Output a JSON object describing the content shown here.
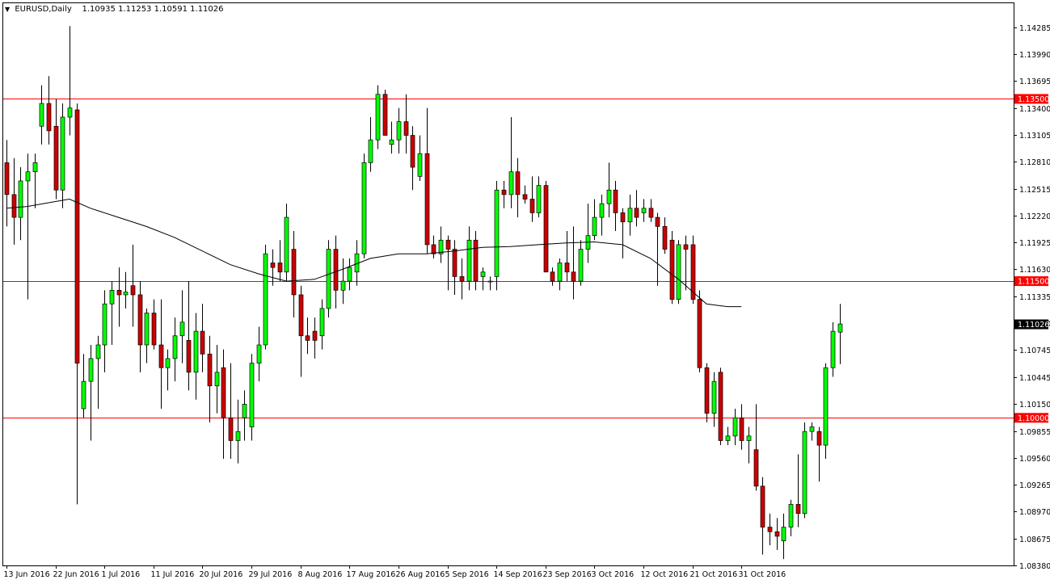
{
  "header": {
    "symbol": "EURUSD,Daily",
    "open": "1.10935",
    "high": "1.11253",
    "low": "1.10591",
    "close": "1.11026"
  },
  "chart_data": {
    "type": "candlestick",
    "symbol": "EURUSD",
    "timeframe": "Daily",
    "ylim": [
      1.0838,
      1.1455
    ],
    "y_ticks": [
      "1.14285",
      "1.13990",
      "1.13695",
      "1.13400",
      "1.13105",
      "1.12810",
      "1.12515",
      "1.12220",
      "1.11925",
      "1.11630",
      "1.11335",
      "1.11040",
      "1.10745",
      "1.10445",
      "1.10150",
      "1.09855",
      "1.09560",
      "1.09265",
      "1.08970",
      "1.08675",
      "1.08380"
    ],
    "x_ticks": [
      {
        "label": "13 Jun 2016",
        "index": 0
      },
      {
        "label": "22 Jun 2016",
        "index": 7
      },
      {
        "label": "1 Jul 2016",
        "index": 14
      },
      {
        "label": "11 Jul 2016",
        "index": 21
      },
      {
        "label": "20 Jul 2016",
        "index": 28
      },
      {
        "label": "29 Jul 2016",
        "index": 35
      },
      {
        "label": "8 Aug 2016",
        "index": 42
      },
      {
        "label": "17 Aug 2016",
        "index": 49
      },
      {
        "label": "26 Aug 2016",
        "index": 56
      },
      {
        "label": "5 Sep 2016",
        "index": 63
      },
      {
        "label": "14 Sep 2016",
        "index": 70
      },
      {
        "label": "23 Sep 2016",
        "index": 77
      },
      {
        "label": "3 Oct 2016",
        "index": 84
      },
      {
        "label": "12 Oct 2016",
        "index": 91
      },
      {
        "label": "21 Oct 2016",
        "index": 98
      },
      {
        "label": "31 Oct 2016",
        "index": 105
      }
    ],
    "levels": [
      {
        "value": 1.135,
        "label": "1.13500"
      },
      {
        "value": 1.115,
        "label": "1.11500"
      },
      {
        "value": 1.1,
        "label": "1.10000"
      }
    ],
    "last_price": {
      "value": 1.11026,
      "label": "1.11026"
    },
    "colors": {
      "bull": "#00ff00",
      "bear": "#cc0000",
      "level": "#ff0000",
      "ma": "#000000",
      "axis": "#000000"
    },
    "candles": [
      [
        1.128,
        1.1305,
        1.121,
        1.1245
      ],
      [
        1.1245,
        1.1285,
        1.119,
        1.122
      ],
      [
        1.122,
        1.1275,
        1.1195,
        1.126
      ],
      [
        1.126,
        1.129,
        1.113,
        1.127
      ],
      [
        1.127,
        1.129,
        1.123,
        1.128
      ],
      [
        1.132,
        1.1365,
        1.13,
        1.1345
      ],
      [
        1.1345,
        1.1375,
        1.13,
        1.1315
      ],
      [
        1.132,
        1.135,
        1.124,
        1.125
      ],
      [
        1.125,
        1.1345,
        1.123,
        1.133
      ],
      [
        1.133,
        1.143,
        1.131,
        1.134
      ],
      [
        1.1338,
        1.1345,
        1.0905,
        1.106
      ],
      [
        1.101,
        1.107,
        1.1,
        1.104
      ],
      [
        1.104,
        1.108,
        1.0975,
        1.1065
      ],
      [
        1.1065,
        1.109,
        1.101,
        1.108
      ],
      [
        1.108,
        1.114,
        1.105,
        1.1125
      ],
      [
        1.1125,
        1.115,
        1.108,
        1.114
      ],
      [
        1.114,
        1.1165,
        1.11,
        1.1135
      ],
      [
        1.1135,
        1.116,
        1.112,
        1.1138
      ],
      [
        1.1145,
        1.119,
        1.11,
        1.1135
      ],
      [
        1.1135,
        1.115,
        1.105,
        1.108
      ],
      [
        1.108,
        1.112,
        1.106,
        1.1115
      ],
      [
        1.1115,
        1.113,
        1.1075,
        1.108
      ],
      [
        1.108,
        1.113,
        1.101,
        1.1055
      ],
      [
        1.1055,
        1.1075,
        1.103,
        1.1065
      ],
      [
        1.1065,
        1.111,
        1.104,
        1.109
      ],
      [
        1.109,
        1.114,
        1.106,
        1.1105
      ],
      [
        1.1085,
        1.115,
        1.103,
        1.105
      ],
      [
        1.105,
        1.1115,
        1.102,
        1.1095
      ],
      [
        1.1095,
        1.1125,
        1.105,
        1.107
      ],
      [
        1.107,
        1.109,
        1.0995,
        1.1035
      ],
      [
        1.1035,
        1.108,
        1.1005,
        1.105
      ],
      [
        1.1055,
        1.1075,
        1.0955,
        1.1
      ],
      [
        1.1,
        1.106,
        1.0955,
        1.0975
      ],
      [
        1.0975,
        1.102,
        1.095,
        1.0985
      ],
      [
        1.1,
        1.103,
        1.0975,
        1.1015
      ],
      [
        1.099,
        1.107,
        1.0975,
        1.106
      ],
      [
        1.106,
        1.11,
        1.104,
        1.108
      ],
      [
        1.108,
        1.119,
        1.1075,
        1.118
      ],
      [
        1.117,
        1.1185,
        1.1145,
        1.1165
      ],
      [
        1.117,
        1.1195,
        1.115,
        1.116
      ],
      [
        1.116,
        1.1235,
        1.115,
        1.122
      ],
      [
        1.1185,
        1.1205,
        1.111,
        1.1135
      ],
      [
        1.1135,
        1.1145,
        1.1045,
        1.109
      ],
      [
        1.109,
        1.111,
        1.107,
        1.1085
      ],
      [
        1.1095,
        1.111,
        1.1065,
        1.1085
      ],
      [
        1.109,
        1.113,
        1.1075,
        1.112
      ],
      [
        1.112,
        1.1195,
        1.111,
        1.1185
      ],
      [
        1.1185,
        1.12,
        1.112,
        1.114
      ],
      [
        1.114,
        1.1175,
        1.1125,
        1.115
      ],
      [
        1.115,
        1.1175,
        1.114,
        1.1165
      ],
      [
        1.116,
        1.1195,
        1.1145,
        1.118
      ],
      [
        1.118,
        1.129,
        1.1175,
        1.128
      ],
      [
        1.128,
        1.133,
        1.127,
        1.1305
      ],
      [
        1.1305,
        1.1365,
        1.1295,
        1.1355
      ],
      [
        1.1355,
        1.136,
        1.131,
        1.131
      ],
      [
        1.13,
        1.1325,
        1.129,
        1.1305
      ],
      [
        1.1305,
        1.134,
        1.129,
        1.1325
      ],
      [
        1.1325,
        1.1355,
        1.129,
        1.131
      ],
      [
        1.131,
        1.132,
        1.125,
        1.1275
      ],
      [
        1.1265,
        1.131,
        1.126,
        1.129
      ],
      [
        1.129,
        1.134,
        1.118,
        1.119
      ],
      [
        1.119,
        1.12,
        1.1175,
        1.118
      ],
      [
        1.118,
        1.121,
        1.117,
        1.1195
      ],
      [
        1.1195,
        1.12,
        1.114,
        1.1185
      ],
      [
        1.1185,
        1.1195,
        1.1135,
        1.1155
      ],
      [
        1.1155,
        1.1175,
        1.113,
        1.115
      ],
      [
        1.115,
        1.121,
        1.114,
        1.1195
      ],
      [
        1.1195,
        1.1205,
        1.114,
        1.115
      ],
      [
        1.1155,
        1.1165,
        1.114,
        1.116
      ],
      [
        1.115,
        1.1155,
        1.114,
        1.115
      ],
      [
        1.1155,
        1.126,
        1.114,
        1.125
      ],
      [
        1.125,
        1.126,
        1.123,
        1.1245
      ],
      [
        1.1245,
        1.133,
        1.123,
        1.127
      ],
      [
        1.127,
        1.1285,
        1.122,
        1.1245
      ],
      [
        1.1245,
        1.1255,
        1.1235,
        1.124
      ],
      [
        1.124,
        1.1265,
        1.1215,
        1.1225
      ],
      [
        1.1225,
        1.1265,
        1.122,
        1.1255
      ],
      [
        1.1255,
        1.126,
        1.116,
        1.116
      ],
      [
        1.116,
        1.1165,
        1.1145,
        1.115
      ],
      [
        1.115,
        1.1175,
        1.114,
        1.117
      ],
      [
        1.117,
        1.1205,
        1.115,
        1.116
      ],
      [
        1.116,
        1.121,
        1.113,
        1.115
      ],
      [
        1.115,
        1.1195,
        1.1145,
        1.1185
      ],
      [
        1.1185,
        1.1235,
        1.117,
        1.12
      ]
    ],
    "candles_b": [
      [
        1.12,
        1.124,
        1.1195,
        1.122
      ],
      [
        1.122,
        1.1245,
        1.12,
        1.1235
      ],
      [
        1.1235,
        1.128,
        1.122,
        1.125
      ],
      [
        1.125,
        1.126,
        1.1205,
        1.1225
      ],
      [
        1.1225,
        1.123,
        1.1175,
        1.1215
      ],
      [
        1.1215,
        1.1245,
        1.12,
        1.123
      ],
      [
        1.123,
        1.125,
        1.121,
        1.122
      ],
      [
        1.1225,
        1.124,
        1.1215,
        1.123
      ],
      [
        1.123,
        1.124,
        1.1215,
        1.122
      ],
      [
        1.122,
        1.1225,
        1.1145,
        1.121
      ],
      [
        1.121,
        1.122,
        1.118,
        1.1185
      ],
      [
        1.1195,
        1.1205,
        1.1125,
        1.113
      ],
      [
        1.113,
        1.1195,
        1.1125,
        1.119
      ],
      [
        1.119,
        1.12,
        1.114,
        1.1185
      ],
      [
        1.119,
        1.12,
        1.1125,
        1.113
      ],
      [
        1.113,
        1.114,
        1.105,
        1.1055
      ],
      [
        1.1055,
        1.106,
        1.0995,
        1.1005
      ],
      [
        1.1005,
        1.105,
        1.099,
        1.104
      ],
      [
        1.105,
        1.1055,
        1.097,
        1.0975
      ],
      [
        1.0975,
        1.099,
        1.097,
        1.098
      ],
      [
        1.098,
        1.101,
        1.097,
        1.1
      ]
    ],
    "candles_c": [
      [
        1.1,
        1.1015,
        1.0965,
        1.0975
      ],
      [
        1.0975,
        1.099,
        1.095,
        1.098
      ],
      [
        1.0965,
        1.1015,
        1.092,
        1.0925
      ],
      [
        1.0925,
        1.0935,
        1.085,
        1.088
      ],
      [
        1.088,
        1.0895,
        1.086,
        1.0875
      ],
      [
        1.0875,
        1.089,
        1.0855,
        1.087
      ],
      [
        1.0865,
        1.0895,
        1.0845,
        1.088
      ],
      [
        1.088,
        1.091,
        1.087,
        1.0905
      ],
      [
        1.0905,
        1.096,
        1.088,
        1.0895
      ],
      [
        1.0895,
        1.0995,
        1.089,
        1.0985
      ],
      [
        1.0985,
        1.0995,
        1.0975,
        1.099
      ],
      [
        1.0985,
        1.099,
        1.093,
        1.097
      ],
      [
        1.097,
        1.106,
        1.0955,
        1.1055
      ],
      [
        1.1055,
        1.1105,
        1.1045,
        1.1095
      ],
      [
        1.1094,
        1.1125,
        1.1059,
        1.1103
      ]
    ],
    "ma": [
      [
        0,
        1.123
      ],
      [
        3,
        1.1232
      ],
      [
        6,
        1.1236
      ],
      [
        9,
        1.124
      ],
      [
        12,
        1.123
      ],
      [
        16,
        1.122
      ],
      [
        20,
        1.121
      ],
      [
        24,
        1.1198
      ],
      [
        28,
        1.1183
      ],
      [
        32,
        1.1168
      ],
      [
        36,
        1.1158
      ],
      [
        40,
        1.115
      ],
      [
        44,
        1.1152
      ],
      [
        48,
        1.1163
      ],
      [
        52,
        1.1175
      ],
      [
        56,
        1.118
      ],
      [
        60,
        1.118
      ],
      [
        64,
        1.1183
      ],
      [
        68,
        1.1187
      ],
      [
        72,
        1.1188
      ],
      [
        76,
        1.119
      ],
      [
        80,
        1.1192
      ],
      [
        84,
        1.1193
      ],
      [
        88,
        1.119
      ],
      [
        92,
        1.1175
      ],
      [
        96,
        1.1152
      ],
      [
        100,
        1.1125
      ],
      [
        103,
        1.1122
      ],
      [
        105,
        1.1122
      ]
    ]
  }
}
